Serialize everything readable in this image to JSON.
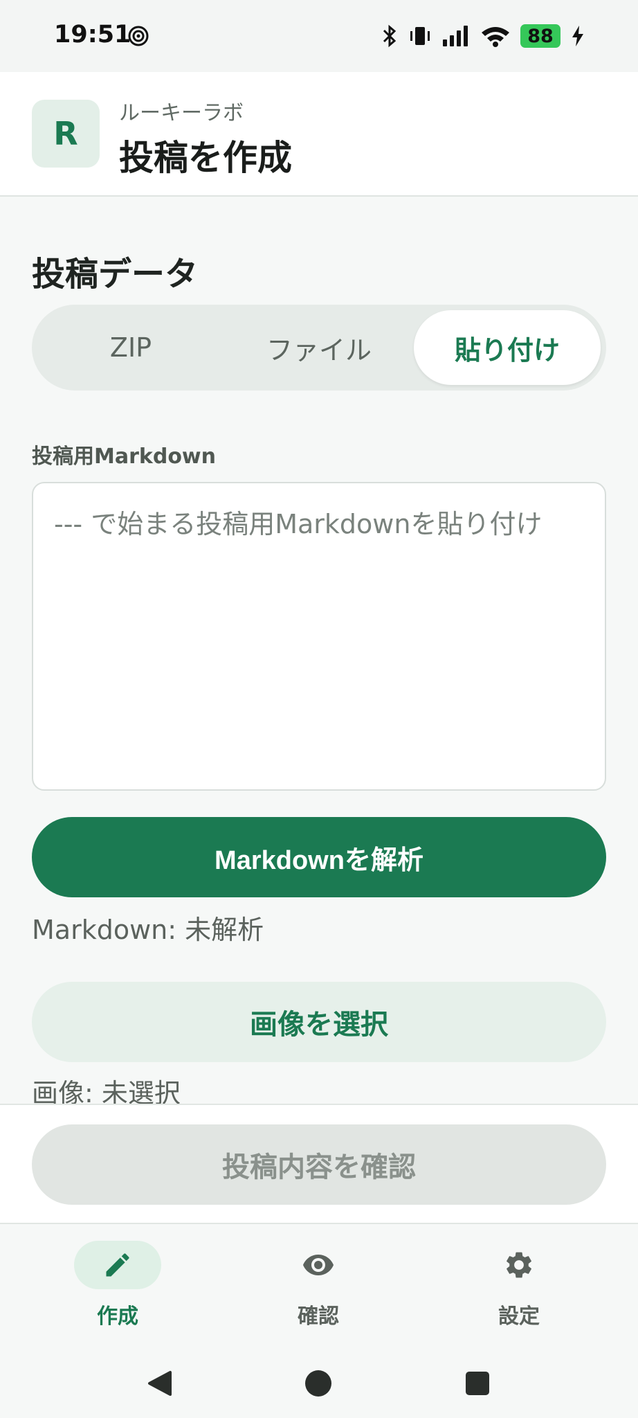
{
  "status_bar": {
    "time": "19:51",
    "battery": "88",
    "icons": [
      "target-icon",
      "bluetooth-icon",
      "vibrate-icon",
      "signal-icon",
      "wifi-icon",
      "battery-icon",
      "charging-icon"
    ]
  },
  "app_bar": {
    "subtitle": "ルーキーラボ",
    "title": "投稿を作成",
    "logo_letter": "R"
  },
  "section": {
    "title": "投稿データ"
  },
  "segmented": {
    "options": [
      {
        "label": "ZIP",
        "selected": false
      },
      {
        "label": "ファイル",
        "selected": false
      },
      {
        "label": "貼り付け",
        "selected": true
      }
    ]
  },
  "markdown_field": {
    "label": "投稿用Markdown",
    "value": "",
    "placeholder": "--- で始まる投稿用Markdownを貼り付け"
  },
  "buttons": {
    "parse": "Markdownを解析",
    "select_image": "画像を選択",
    "confirm": "投稿内容を確認"
  },
  "status": {
    "markdown": "Markdown: 未解析",
    "image": "画像: 未選択"
  },
  "bottom_nav": {
    "items": [
      {
        "label": "作成",
        "icon": "pencil-icon",
        "active": true
      },
      {
        "label": "確認",
        "icon": "eye-icon",
        "active": false
      },
      {
        "label": "設定",
        "icon": "gear-icon",
        "active": false
      }
    ]
  },
  "colors": {
    "accent": "#1b7a52",
    "accent_soft": "#e6f0ea",
    "disabled": "#e1e5e2"
  }
}
